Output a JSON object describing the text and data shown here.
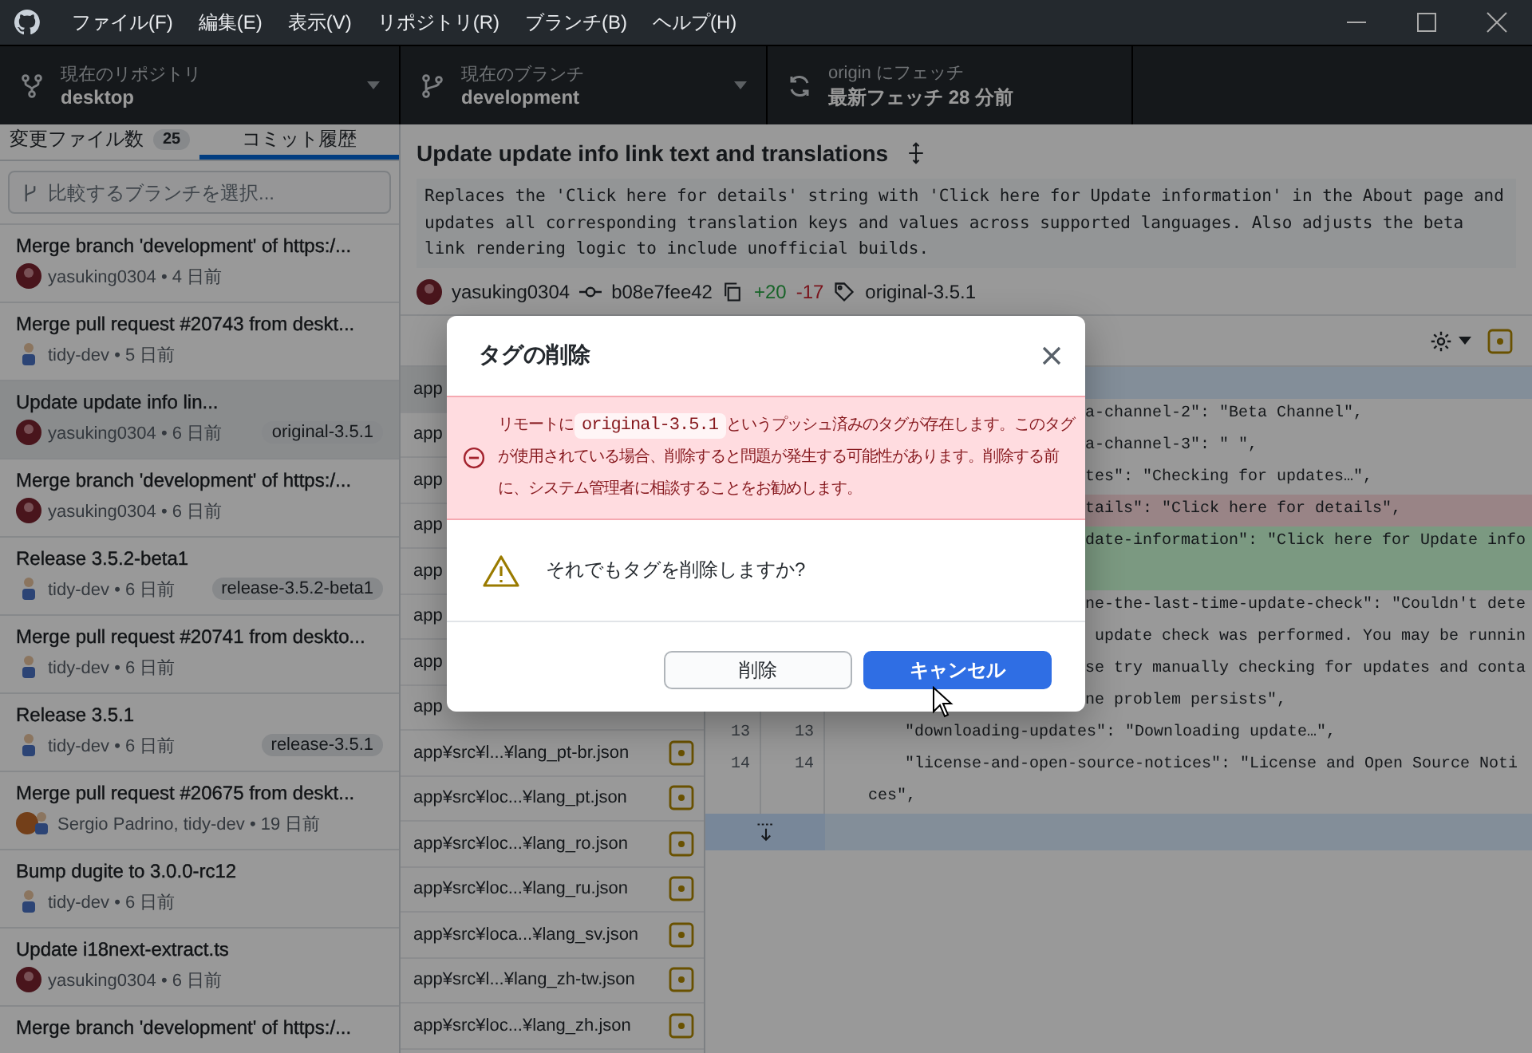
{
  "title_bar": {
    "menu": [
      "ファイル(F)",
      "編集(E)",
      "表示(V)",
      "リポジトリ(R)",
      "ブランチ(B)",
      "ヘルプ(H)"
    ]
  },
  "toolbar": {
    "repository": {
      "label": "現在のリポジトリ",
      "value": "desktop"
    },
    "branch": {
      "label": "現在のブランチ",
      "value": "development"
    },
    "fetch": {
      "label": "origin にフェッチ",
      "value": "最新フェッチ 28 分前"
    }
  },
  "sidebar": {
    "tabs": [
      {
        "label": "変更ファイル数",
        "count": "25",
        "selected": false
      },
      {
        "label": "コミット履歴",
        "selected": true
      }
    ],
    "branch_filter": {
      "placeholder": "比較するブランチを選択..."
    },
    "commits": [
      {
        "title": "Merge branch 'development' of https:/...",
        "byline": "yasuking0304 • 4 日前",
        "avatar": {
          "kind": "photo"
        },
        "selected": false
      },
      {
        "title": "Merge pull request #20743 from deskt...",
        "byline": "tidy-dev • 5 日前",
        "avatar": {
          "kind": "figure"
        },
        "selected": false
      },
      {
        "title": "Update update info lin...",
        "byline": "yasuking0304 • 6 日前",
        "avatar": {
          "kind": "photo"
        },
        "tag": "original-3.5.1",
        "selected": true
      },
      {
        "title": "Merge branch 'development' of https:/...",
        "byline": "yasuking0304 • 6 日前",
        "avatar": {
          "kind": "photo"
        },
        "selected": false
      },
      {
        "title": "Release 3.5.2-beta1",
        "byline": "tidy-dev • 6 日前",
        "avatar": {
          "kind": "figure"
        },
        "tag": "release-3.5.2-beta1",
        "selected": false
      },
      {
        "title": "Merge pull request #20741 from deskto...",
        "byline": "tidy-dev • 6 日前",
        "avatar": {
          "kind": "figure"
        },
        "selected": false
      },
      {
        "title": "Release 3.5.1",
        "byline": "tidy-dev • 6 日前",
        "avatar": {
          "kind": "figure"
        },
        "tag": "release-3.5.1",
        "selected": false
      },
      {
        "title": "Merge pull request #20675 from deskt...",
        "byline": "Sergio Padrino, tidy-dev • 19 日前",
        "avatar": {
          "kind": "pair"
        },
        "selected": false
      },
      {
        "title": "Bump dugite to 3.0.0-rc12",
        "byline": "tidy-dev • 6 日前",
        "avatar": {
          "kind": "figure"
        },
        "selected": false
      },
      {
        "title": "Update i18next-extract.ts",
        "byline": "yasuking0304 • 6 日前",
        "avatar": {
          "kind": "photo"
        },
        "selected": false
      },
      {
        "title": "Merge branch 'development' of https:/...",
        "selected": false
      }
    ]
  },
  "commit": {
    "title": "Update update info link text and translations",
    "description": "Replaces the 'Click here for details' string with 'Click here for Update information' in the About page and updates all corresponding translation keys and values across supported languages. Also adjusts the beta link rendering logic to include unofficial builds.",
    "author": "yasuking0304",
    "sha": "b08e7fee42",
    "additions": "+20",
    "deletions": "-17",
    "tag": "original-3.5.1"
  },
  "files": [
    {
      "path": "app",
      "selected": true
    },
    {
      "path": "app",
      "selected": false
    },
    {
      "path": "app",
      "selected": false
    },
    {
      "path": "app",
      "selected": false
    },
    {
      "path": "app",
      "selected": false
    },
    {
      "path": "app",
      "selected": false
    },
    {
      "path": "app",
      "selected": false
    },
    {
      "path": "app",
      "selected": false
    },
    {
      "path": "app¥src¥l...¥lang_pt-br.json",
      "kind": "modified",
      "selected": false
    },
    {
      "path": "app¥src¥loc...¥lang_pt.json",
      "kind": "modified",
      "selected": false
    },
    {
      "path": "app¥src¥loc...¥lang_ro.json",
      "kind": "modified",
      "selected": false
    },
    {
      "path": "app¥src¥loc...¥lang_ru.json",
      "kind": "modified",
      "selected": false
    },
    {
      "path": "app¥src¥loca...¥lang_sv.json",
      "kind": "modified",
      "selected": false
    },
    {
      "path": "app¥src¥l...¥lang_zh-tw.json",
      "kind": "modified",
      "selected": false
    },
    {
      "path": "app¥src¥loc...¥lang_zh.json",
      "kind": "modified",
      "selected": false
    }
  ],
  "diff": {
    "lines": [
      {
        "kind": "hunk"
      },
      {
        "kind": "context",
        "text": "a-channel-2\": \"Beta Channel\",",
        "clipped": true
      },
      {
        "kind": "context",
        "text": "a-channel-3\": \" \",",
        "clipped": true
      },
      {
        "kind": "context",
        "text": "tes\": \"Checking for updates…\",",
        "clipped": true
      },
      {
        "kind": "deleted",
        "text": "tails\": \"Click here for details\",",
        "clipped": true
      },
      {
        "kind": "added",
        "text": "date-information\": \"Click here for Update info",
        "clipped": true
      },
      {
        "kind": "added"
      },
      {
        "kind": "context",
        "text": "ne-the-last-time-update-check\": \"Couldn't dete",
        "clipped": true
      },
      {
        "kind": "context",
        "text": " update check was performed. You may be runnin",
        "clipped": true
      },
      {
        "kind": "context",
        "text": "se try manually checking for updates and conta",
        "clipped": true
      },
      {
        "kind": "context",
        "text": "ne problem persists\",",
        "clipped": true
      },
      {
        "kind": "context",
        "old": "13",
        "new": "13",
        "text": "\"downloading-updates\": \"Downloading update…\",",
        "clipped": false
      },
      {
        "kind": "context",
        "old": "14",
        "new": "14",
        "text": "\"license-and-open-source-notices\": \"License and Open Source Notices\",",
        "clipped": false
      },
      {
        "kind": "expander"
      }
    ]
  },
  "dialog": {
    "title": "タグの削除",
    "error": {
      "before": "リモートに",
      "code": "original-3.5.1",
      "after": "というプッシュ済みのタグが存在します。このタグが使用されている場合、削除すると問題が発生する可能性があります。削除する前に、システム管理者に相談することをお勧めします。"
    },
    "question": "それでもタグを削除しますか?",
    "buttons": [
      {
        "label": "削除",
        "kind": "secondary"
      },
      {
        "label": "キャンセル",
        "kind": "primary",
        "hovered": true
      }
    ]
  }
}
